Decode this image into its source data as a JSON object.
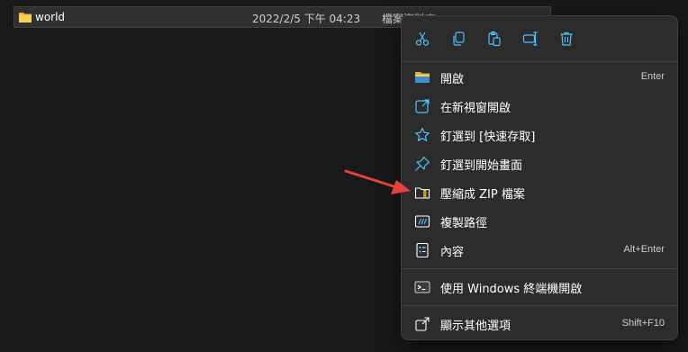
{
  "file_row": {
    "name": "world",
    "date_modified": "2022/2/5 下午 04:23",
    "type": "檔案資料夾"
  },
  "context_menu": {
    "toolbar": [
      {
        "name": "cut",
        "icon": "scissors-icon"
      },
      {
        "name": "copy",
        "icon": "copy-icon"
      },
      {
        "name": "paste",
        "icon": "paste-icon"
      },
      {
        "name": "rename",
        "icon": "rename-icon"
      },
      {
        "name": "delete",
        "icon": "trash-icon"
      }
    ],
    "items": [
      {
        "label": "開啟",
        "shortcut": "Enter",
        "icon": "folder-icon"
      },
      {
        "label": "在新視窗開啟",
        "shortcut": "",
        "icon": "open-external-icon"
      },
      {
        "label": "釘選到 [快速存取]",
        "shortcut": "",
        "icon": "star-icon"
      },
      {
        "label": "釘選到開始畫面",
        "shortcut": "",
        "icon": "pin-icon"
      },
      {
        "label": "壓縮成 ZIP 檔案",
        "shortcut": "",
        "icon": "zip-folder-icon"
      },
      {
        "label": "複製路徑",
        "shortcut": "",
        "icon": "copy-path-icon"
      },
      {
        "label": "內容",
        "shortcut": "Alt+Enter",
        "icon": "properties-icon"
      },
      {
        "label": "使用 Windows 終端機開啟",
        "shortcut": "",
        "icon": "terminal-icon"
      },
      {
        "label": "顯示其他選項",
        "shortcut": "Shift+F10",
        "icon": "more-options-icon"
      }
    ]
  },
  "colors": {
    "accent": "#4cc2ff",
    "folder": "#f4c542",
    "annotation_arrow": "#e8403a"
  }
}
